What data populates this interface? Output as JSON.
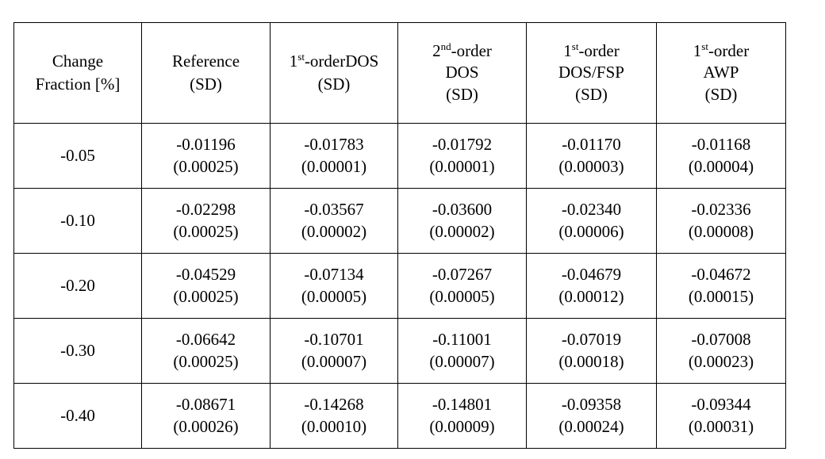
{
  "table": {
    "columns": [
      {
        "id": "change-fraction",
        "lines": [
          "Change",
          "Fraction  [%]"
        ],
        "has_superscript": false
      },
      {
        "id": "reference",
        "lines": [
          "Reference",
          "(SD)"
        ],
        "has_superscript": false
      },
      {
        "id": "first-order-dos",
        "order_num": "1",
        "order_sup": "st",
        "order_rest": "-orderDOS",
        "lines": [
          "1st-orderDOS",
          "(SD)"
        ],
        "has_superscript": true
      },
      {
        "id": "second-order-dos",
        "order_num": "2",
        "order_sup": "nd",
        "order_rest": "-order",
        "lines": [
          "2nd-order",
          "DOS",
          "(SD)"
        ],
        "line2": "DOS",
        "line3": "(SD)",
        "has_superscript": true
      },
      {
        "id": "first-order-dos-fsp",
        "order_num": "1",
        "order_sup": "st",
        "order_rest": "-order",
        "lines": [
          "1st-order",
          "DOS/FSP",
          "(SD)"
        ],
        "line2": "DOS/FSP",
        "line3": "(SD)",
        "has_superscript": true
      },
      {
        "id": "first-order-awp",
        "order_num": "1",
        "order_sup": "st",
        "order_rest": "-order",
        "lines": [
          "1st-order",
          "AWP",
          "(SD)"
        ],
        "line2": "AWP",
        "line3": "(SD)",
        "has_superscript": true
      }
    ],
    "rows": [
      {
        "label": "-0.05",
        "cells": [
          {
            "value": "-0.01196",
            "sd": "(0.00025)"
          },
          {
            "value": "-0.01783",
            "sd": "(0.00001)"
          },
          {
            "value": "-0.01792",
            "sd": "(0.00001)"
          },
          {
            "value": "-0.01170",
            "sd": "(0.00003)"
          },
          {
            "value": "-0.01168",
            "sd": "(0.00004)"
          }
        ]
      },
      {
        "label": "-0.10",
        "cells": [
          {
            "value": "-0.02298",
            "sd": "(0.00025)"
          },
          {
            "value": "-0.03567",
            "sd": "(0.00002)"
          },
          {
            "value": "-0.03600",
            "sd": "(0.00002)"
          },
          {
            "value": "-0.02340",
            "sd": "(0.00006)"
          },
          {
            "value": "-0.02336",
            "sd": "(0.00008)"
          }
        ]
      },
      {
        "label": "-0.20",
        "cells": [
          {
            "value": "-0.04529",
            "sd": "(0.00025)"
          },
          {
            "value": "-0.07134",
            "sd": "(0.00005)"
          },
          {
            "value": "-0.07267",
            "sd": "(0.00005)"
          },
          {
            "value": "-0.04679",
            "sd": "(0.00012)"
          },
          {
            "value": "-0.04672",
            "sd": "(0.00015)"
          }
        ]
      },
      {
        "label": "-0.30",
        "cells": [
          {
            "value": "-0.06642",
            "sd": "(0.00025)"
          },
          {
            "value": "-0.10701",
            "sd": "(0.00007)"
          },
          {
            "value": "-0.11001",
            "sd": "(0.00007)"
          },
          {
            "value": "-0.07019",
            "sd": "(0.00018)"
          },
          {
            "value": "-0.07008",
            "sd": "(0.00023)"
          }
        ]
      },
      {
        "label": "-0.40",
        "cells": [
          {
            "value": "-0.08671",
            "sd": "(0.00026)"
          },
          {
            "value": "-0.14268",
            "sd": "(0.00010)"
          },
          {
            "value": "-0.14801",
            "sd": "(0.00009)"
          },
          {
            "value": "-0.09358",
            "sd": "(0.00024)"
          },
          {
            "value": "-0.09344",
            "sd": "(0.00031)"
          }
        ]
      }
    ]
  },
  "colors": {
    "border": "#000000",
    "text": "#000000",
    "background": "#ffffff"
  }
}
